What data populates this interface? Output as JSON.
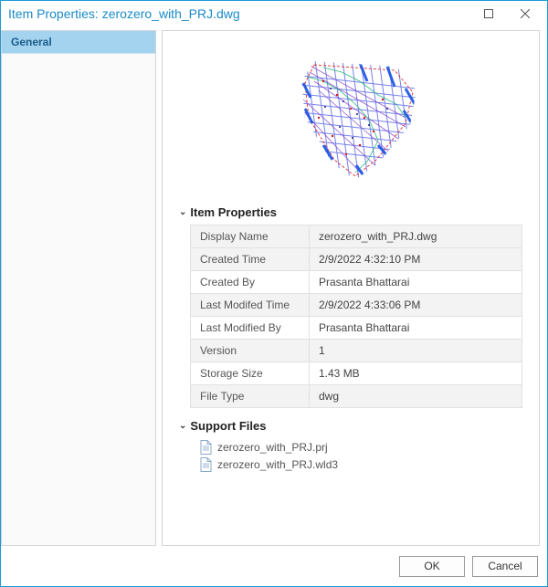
{
  "window": {
    "title": "Item Properties: zerozero_with_PRJ.dwg"
  },
  "sidebar": {
    "tabs": [
      {
        "label": "General"
      }
    ]
  },
  "sections": {
    "item_properties": {
      "label": "Item Properties"
    },
    "support_files": {
      "label": "Support Files"
    }
  },
  "properties": [
    {
      "key": "Display Name",
      "value": "zerozero_with_PRJ.dwg"
    },
    {
      "key": "Created Time",
      "value": "2/9/2022 4:32:10 PM"
    },
    {
      "key": "Created By",
      "value": "Prasanta Bhattarai"
    },
    {
      "key": "Last Modifed Time",
      "value": "2/9/2022 4:33:06 PM"
    },
    {
      "key": "Last Modified By",
      "value": "Prasanta Bhattarai"
    },
    {
      "key": "Version",
      "value": "1"
    },
    {
      "key": "Storage Size",
      "value": "1.43 MB"
    },
    {
      "key": "File Type",
      "value": "dwg"
    }
  ],
  "support_files": [
    {
      "name": "zerozero_with_PRJ.prj"
    },
    {
      "name": "zerozero_with_PRJ.wld3"
    }
  ],
  "footer": {
    "ok": "OK",
    "cancel": "Cancel"
  }
}
